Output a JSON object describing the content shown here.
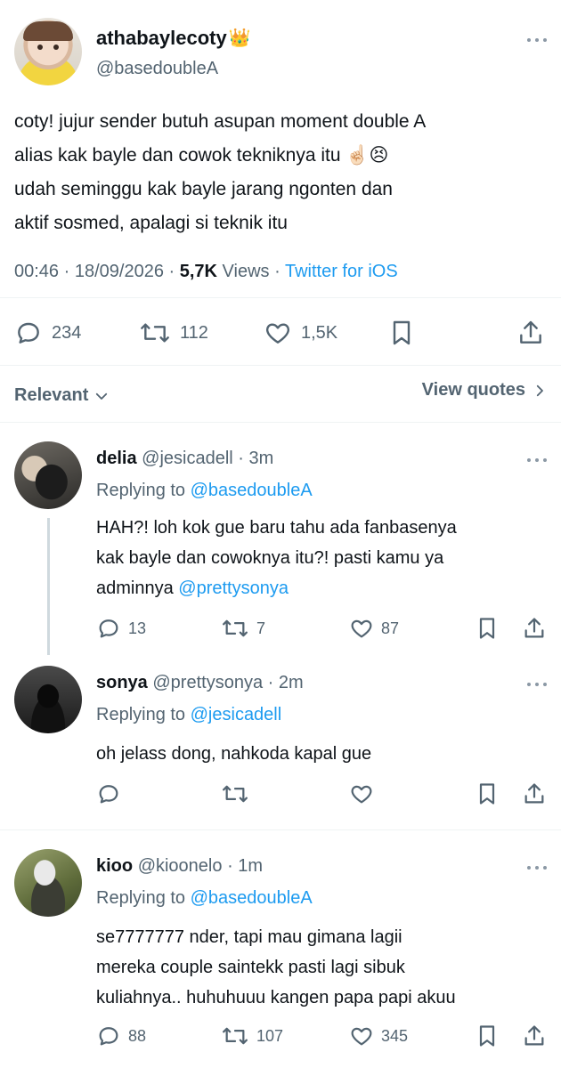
{
  "tweet": {
    "display_name": "athabaylecoty",
    "crown_emoji": "👑",
    "handle": "@basedoubleA",
    "text_lines": [
      "coty! jujur sender butuh asupan moment double A",
      "alias kak bayle dan cowok tekniknya itu ☝🏻😣",
      "udah seminggu kak bayle jarang ngonten dan",
      "aktif sosmed, apalagi si teknik itu"
    ],
    "time": "00:46",
    "date": "18/09/2026",
    "views_count": "5,7K",
    "views_label": "Views",
    "source": "Twitter for iOS",
    "replies": "234",
    "retweets": "112",
    "likes": "1,5K"
  },
  "filter": {
    "relevant_label": "Relevant",
    "view_quotes_label": "View quotes"
  },
  "replies": [
    {
      "name": "delia",
      "handle": "@jesicadell",
      "time": "3m",
      "replying_prefix": "Replying to",
      "replying_to": "@basedoubleA",
      "lines": [
        "HAH?! loh kok gue baru tahu ada fanbasenya",
        "kak bayle dan cowoknya itu?! pasti kamu ya",
        "adminnya"
      ],
      "mention": "@prettysonya",
      "replies": "13",
      "retweets": "7",
      "likes": "87"
    },
    {
      "name": "sonya",
      "handle": "@prettysonya",
      "time": "2m",
      "replying_prefix": "Replying to",
      "replying_to": "@jesicadell",
      "lines": [
        "oh jelass dong, nahkoda kapal gue"
      ]
    },
    {
      "name": "kioo",
      "handle": "@kioonelo",
      "time": "1m",
      "replying_prefix": "Replying to",
      "replying_to": "@basedoubleA",
      "lines": [
        "se7777777 nder, tapi mau gimana lagii",
        "mereka couple saintekk pasti lagi sibuk",
        "kuliahnya.. huhuhuuu kangen papa papi akuu"
      ],
      "replies": "88",
      "retweets": "107",
      "likes": "345"
    }
  ],
  "colors": {
    "link": "#1d9bf0",
    "secondary_text": "#536471",
    "primary_text": "#0f1419",
    "divider": "#eff3f4"
  },
  "icons": [
    "reply-icon",
    "retweet-icon",
    "like-icon",
    "bookmark-icon",
    "share-icon",
    "more-icon",
    "chevron-down-icon",
    "chevron-right-icon"
  ]
}
